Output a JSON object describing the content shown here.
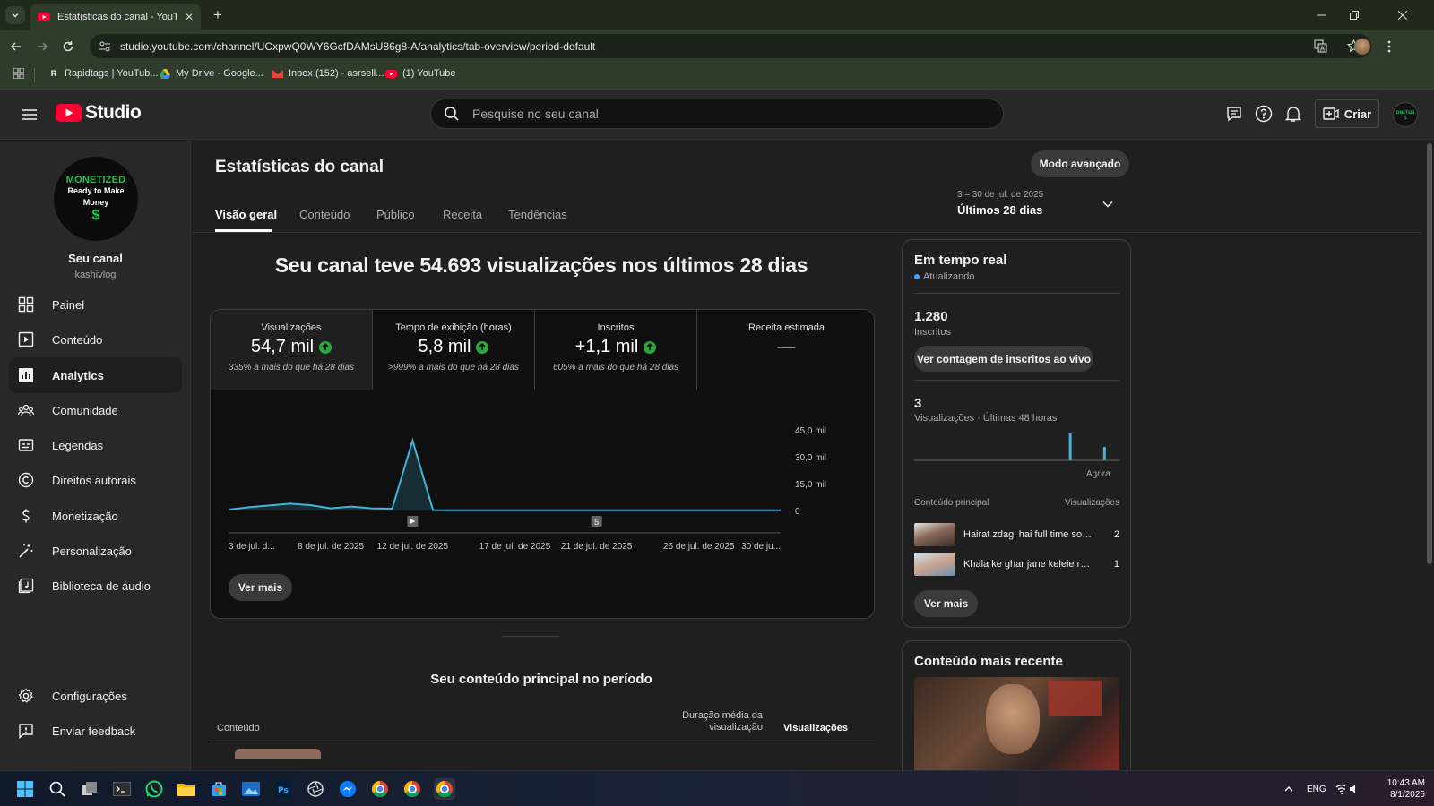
{
  "browser": {
    "tab_title": "Estatísticas do canal - YouTube",
    "url": "studio.youtube.com/channel/UCxpwQ0WY6GcfDAMsU86g8-A/analytics/tab-overview/period-default",
    "bookmarks": [
      {
        "label": "Rapidtags | YouTub...",
        "icon": "rapidtags-icon"
      },
      {
        "label": "My Drive - Google...",
        "icon": "google-drive-icon"
      },
      {
        "label": "Inbox (152) - asrsell...",
        "icon": "gmail-icon"
      },
      {
        "label": "(1) YouTube",
        "icon": "youtube-icon"
      }
    ]
  },
  "header": {
    "logo_text": "Studio",
    "search_placeholder": "Pesquise no seu canal",
    "create_label": "Criar"
  },
  "sidebar": {
    "avatar_line1": "MONETIZED",
    "avatar_line2": "Ready to Make",
    "avatar_line3": "Money",
    "avatar_symbol": "$",
    "channel_name": "Seu canal",
    "channel_handle": "kashivlog",
    "items": [
      {
        "label": "Painel",
        "icon": "dashboard-icon"
      },
      {
        "label": "Conteúdo",
        "icon": "content-icon"
      },
      {
        "label": "Analytics",
        "icon": "analytics-icon",
        "active": true
      },
      {
        "label": "Comunidade",
        "icon": "community-icon"
      },
      {
        "label": "Legendas",
        "icon": "subtitles-icon"
      },
      {
        "label": "Direitos autorais",
        "icon": "copyright-icon"
      },
      {
        "label": "Monetização",
        "icon": "monetization-icon"
      },
      {
        "label": "Personalização",
        "icon": "customization-icon"
      },
      {
        "label": "Biblioteca de áudio",
        "icon": "audio-library-icon"
      }
    ],
    "bottom_items": [
      {
        "label": "Configurações",
        "icon": "settings-icon"
      },
      {
        "label": "Enviar feedback",
        "icon": "feedback-icon"
      }
    ]
  },
  "main": {
    "title": "Estatísticas do canal",
    "advanced_mode_label": "Modo avançado",
    "tabs": [
      "Visão geral",
      "Conteúdo",
      "Público",
      "Receita",
      "Tendências"
    ],
    "date_range": "3 – 30 de jul. de 2025",
    "date_label": "Últimos 28 dias",
    "headline": "Seu canal teve 54.693 visualizações nos últimos 28 dias",
    "metrics": [
      {
        "label": "Visualizações",
        "value": "54,7 mil",
        "trend": "up",
        "comparison": "335% a mais do que há 28 dias"
      },
      {
        "label": "Tempo de exibição (horas)",
        "value": "5,8 mil",
        "trend": "up",
        "comparison": ">999% a mais do que há 28 dias"
      },
      {
        "label": "Inscritos",
        "value": "+1,1 mil",
        "trend": "up",
        "comparison": "605% a mais do que há 28 dias"
      },
      {
        "label": "Receita estimada",
        "value": "—",
        "trend": "none",
        "comparison": ""
      }
    ],
    "see_more_label": "Ver mais",
    "top_content_title": "Seu conteúdo principal no período",
    "table_headers": {
      "content": "Conteúdo",
      "avg_duration": "Duração média da visualização",
      "views": "Visualizações"
    }
  },
  "chart_data": {
    "type": "area",
    "title": "",
    "ylabel": "Visualizações",
    "x_tick_labels": [
      "3 de jul. d...",
      "8 de jul. de 2025",
      "12 de jul. de 2025",
      "17 de jul. de 2025",
      "21 de jul. de 2025",
      "26 de jul. de 2025",
      "30 de ju..."
    ],
    "y_tick_labels": [
      "45,0 mil",
      "30,0 mil",
      "15,0 mil",
      "0"
    ],
    "ylim": [
      0,
      45000
    ],
    "x": [
      "2025-07-03",
      "2025-07-04",
      "2025-07-05",
      "2025-07-06",
      "2025-07-07",
      "2025-07-08",
      "2025-07-09",
      "2025-07-10",
      "2025-07-11",
      "2025-07-12",
      "2025-07-13",
      "2025-07-14",
      "2025-07-15",
      "2025-07-16",
      "2025-07-17",
      "2025-07-18",
      "2025-07-19",
      "2025-07-20",
      "2025-07-21",
      "2025-07-22",
      "2025-07-23",
      "2025-07-24",
      "2025-07-25",
      "2025-07-26",
      "2025-07-27",
      "2025-07-28",
      "2025-07-29",
      "2025-07-30"
    ],
    "series": [
      {
        "values": [
          500,
          1800,
          2800,
          3800,
          3000,
          1200,
          2200,
          1200,
          1000,
          39000,
          200,
          150,
          120,
          100,
          100,
          100,
          100,
          100,
          100,
          100,
          100,
          100,
          100,
          100,
          100,
          100,
          100,
          100
        ]
      }
    ],
    "markers": [
      {
        "date": "2025-07-12",
        "kind": "video-published-icon"
      },
      {
        "date": "2025-07-21",
        "kind": "5"
      }
    ],
    "grid": false,
    "line_color": "#41b4d9"
  },
  "realtime": {
    "title": "Em tempo real",
    "status": "Atualizando",
    "subscribers_value": "1.280",
    "subscribers_label": "Inscritos",
    "live_count_button": "Ver contagem de inscritos ao vivo",
    "views_value": "3",
    "views_label": "Visualizações · Últimas 48 horas",
    "now_label": "Agora",
    "hourly_views": [
      0,
      0,
      0,
      0,
      0,
      0,
      0,
      0,
      0,
      0,
      0,
      0,
      0,
      0,
      0,
      0,
      0,
      0,
      0,
      0,
      0,
      0,
      0,
      0,
      0,
      0,
      0,
      0,
      0,
      0,
      0,
      0,
      0,
      0,
      0,
      0,
      2,
      0,
      0,
      0,
      0,
      0,
      0,
      0,
      1,
      0,
      0,
      0
    ],
    "content_header": "Conteúdo principal",
    "views_header": "Visualizações",
    "top_videos": [
      {
        "title": "Hairat zdagi hai full time soch...",
        "views": "2"
      },
      {
        "title": "Khala ke ghar jane keleie read...",
        "views": "1"
      }
    ],
    "see_more_label": "Ver mais"
  },
  "latest": {
    "title": "Conteúdo mais recente"
  },
  "taskbar": {
    "language": "ENG",
    "time": "10:43 AM",
    "date": "8/1/2025"
  }
}
